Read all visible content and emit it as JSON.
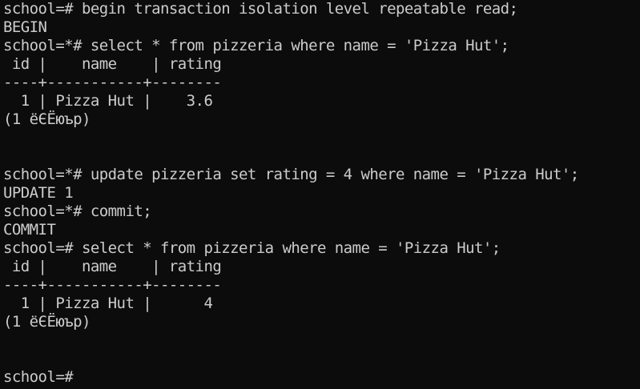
{
  "terminal": {
    "lines": [
      "school=# begin transaction isolation level repeatable read;",
      "BEGIN",
      "school=*# select * from pizzeria where name = 'Pizza Hut';",
      " id |    name    | rating",
      "----+-----------+--------",
      "  1 | Pizza Hut |    3.6",
      "(1 ёЄЁюър)",
      "",
      "",
      "school=*# update pizzeria set rating = 4 where name = 'Pizza Hut';",
      "UPDATE 1",
      "school=*# commit;",
      "COMMIT",
      "school=# select * from pizzeria where name = 'Pizza Hut';",
      " id |    name    | rating",
      "----+-----------+--------",
      "  1 | Pizza Hut |      4",
      "(1 ёЄЁюър)",
      "",
      "",
      "school=# "
    ]
  },
  "colors": {
    "background": "#0c0c0c",
    "foreground": "#cccccc"
  }
}
